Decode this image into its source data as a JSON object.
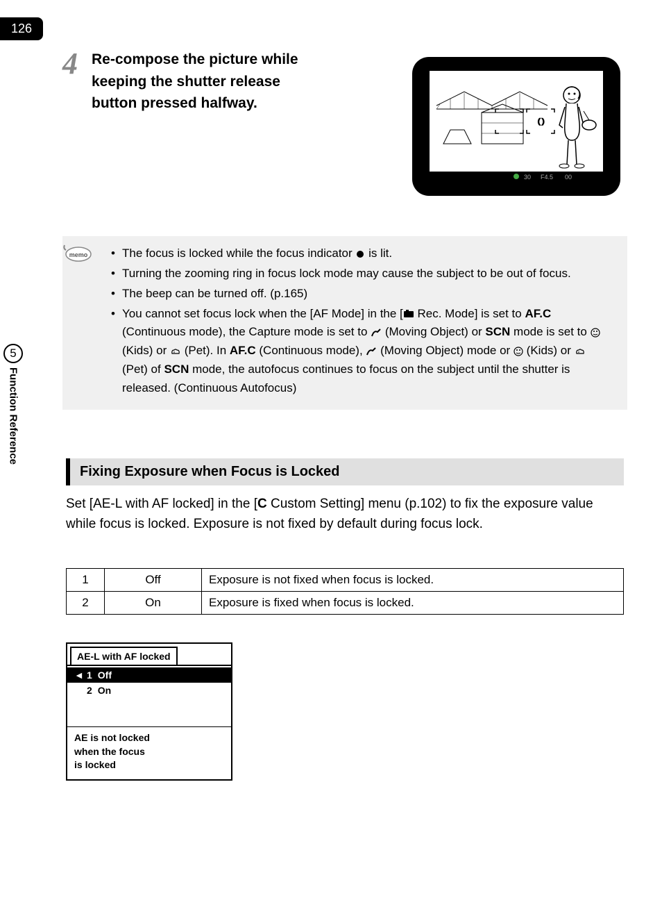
{
  "page_number": "126",
  "step": {
    "number": "4",
    "text": "Re-compose the picture while keeping the shutter release button pressed halfway."
  },
  "memo": {
    "items": [
      "The focus is locked while the focus indicator ] is lit.",
      "Turning the zooming ring in focus lock mode may cause the subject to be out of focus.",
      "The beep can be turned off. (p.165)",
      "You cannot set focus lock when the [AF Mode] in the [A Rec. Mode] is set to AF.C (Continuous mode), the Capture mode is set to \\ (Moving Object) or H mode is set to Q (Kids) or E (Pet). In AF.C (Continuous mode), \\ (Moving Object) mode or Q (Kids) or E (Pet) of H mode, the autofocus continues to focus on the subject until the shutter is released. (Continuous Autofocus)"
    ]
  },
  "side_tab": {
    "number": "5",
    "text": "Function Reference"
  },
  "section": {
    "header": "Fixing Exposure when Focus is Locked",
    "body": "Set [AE-L with AF locked] in the [A Custom Setting] menu (p.102) to fix the exposure value while focus is locked. Exposure is not fixed by default during focus lock."
  },
  "options_table": [
    {
      "num": "1",
      "label": "Off",
      "desc": "Exposure is not fixed when focus is locked."
    },
    {
      "num": "2",
      "label": "On",
      "desc": "Exposure is fixed when focus is locked."
    }
  ],
  "menu_box": {
    "title": "AE-L with AF locked",
    "options": [
      {
        "num": "1",
        "label": "Off",
        "selected": true
      },
      {
        "num": "2",
        "label": "On",
        "selected": false
      }
    ],
    "desc_lines": [
      "AE is not locked",
      "when the focus",
      "is locked"
    ]
  }
}
